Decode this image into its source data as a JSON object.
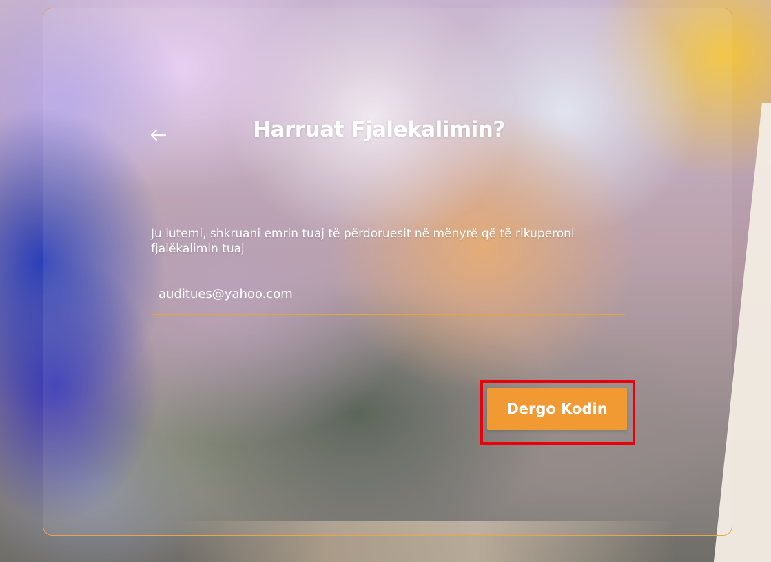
{
  "background": {
    "accent_color": "#f19a34",
    "card_border_color": "#e9a54c",
    "highlight_color": "#e8000b"
  },
  "header": {
    "back_icon": "arrow-left-icon",
    "title": "Harruat Fjalekalimin?"
  },
  "form": {
    "instructions": "Ju lutemi, shkruani emrin tuaj të përdoruesit në mënyrë që të rikuperoni fjalëkalimin tuaj",
    "username_value": "auditues@yahoo.com"
  },
  "actions": {
    "send_code_label": "Dergo Kodin"
  }
}
